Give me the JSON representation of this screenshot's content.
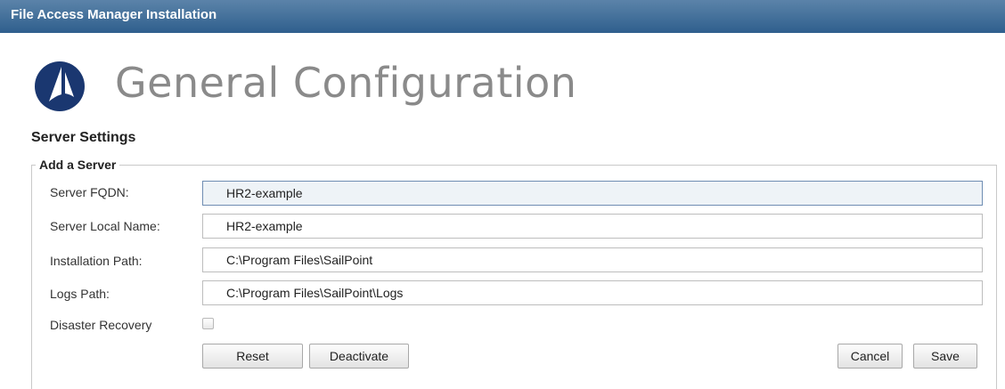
{
  "window": {
    "title": "File Access Manager Installation"
  },
  "page": {
    "title": "General Configuration",
    "logo_icon": "sailpoint-logo-icon"
  },
  "section": {
    "title": "Server Settings"
  },
  "group": {
    "legend": "Add a Server"
  },
  "form": {
    "fqdn": {
      "label": "Server FQDN:",
      "value": "HR2-example"
    },
    "local_name": {
      "label": "Server Local Name:",
      "value": "HR2-example"
    },
    "install_path": {
      "label": "Installation Path:",
      "value": "C:\\Program Files\\SailPoint"
    },
    "logs_path": {
      "label": "Logs Path:",
      "value": "C:\\Program Files\\SailPoint\\Logs"
    },
    "disaster_recovery": {
      "label": "Disaster Recovery",
      "checked": false
    }
  },
  "buttons": {
    "reset": "Reset",
    "deactivate": "Deactivate",
    "cancel": "Cancel",
    "save": "Save"
  },
  "colors": {
    "titlebar": "#3d6a95",
    "title_text": "#8a8a8a",
    "logo": "#1a3770"
  }
}
